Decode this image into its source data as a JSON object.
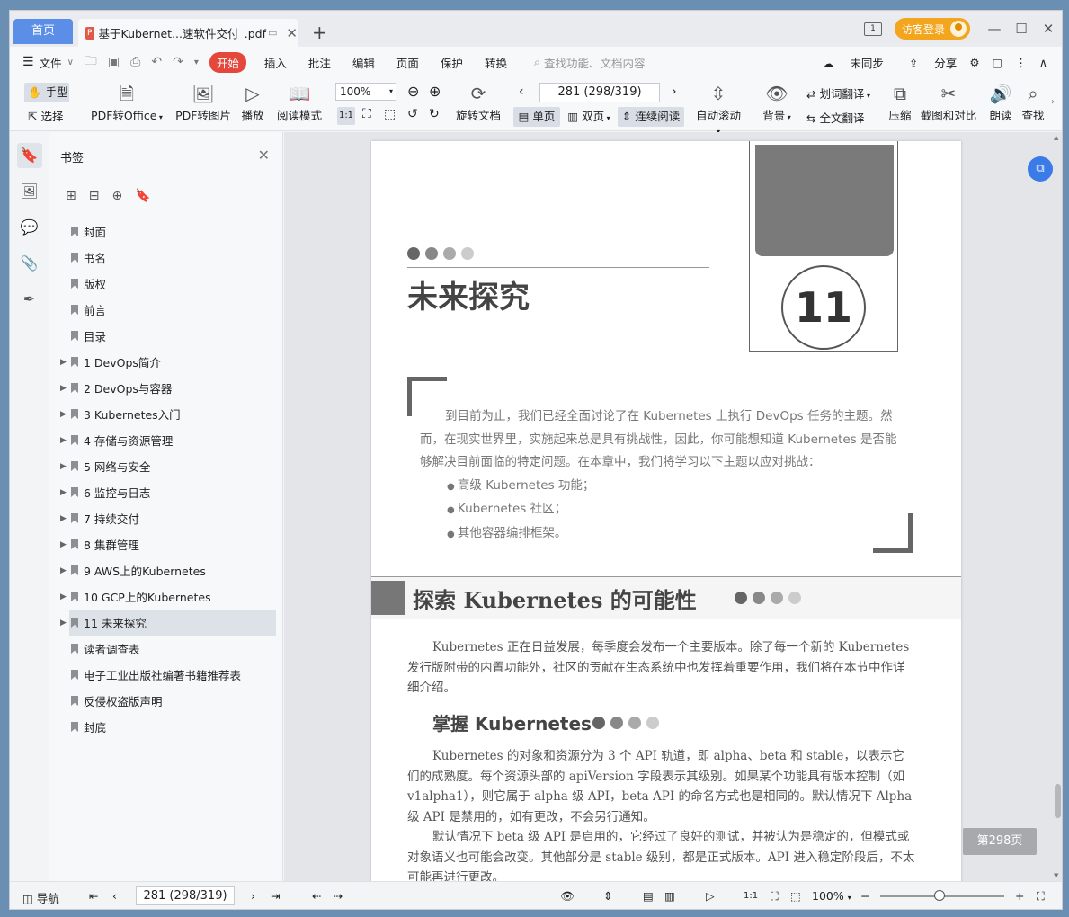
{
  "titlebar": {
    "home_tab": "首页",
    "doc_tab_title": "基于Kubernet...速软件交付_.pdf",
    "new_tab": "+",
    "box_icon_label": "1",
    "visitor_login": "访客登录"
  },
  "menubar": {
    "file": "文件",
    "start": "开始",
    "insert": "插入",
    "annotate": "批注",
    "edit": "编辑",
    "page": "页面",
    "protect": "保护",
    "convert": "转换",
    "search_placeholder": "查找功能、文档内容",
    "sync": "未同步",
    "share": "分享"
  },
  "ribbon": {
    "hand": "手型",
    "select": "选择",
    "pdf_to_office": "PDF转Office",
    "pdf_to_image": "PDF转图片",
    "play": "播放",
    "read_mode": "阅读模式",
    "zoom": "100%",
    "rotate_doc": "旋转文档",
    "page_indicator": "281 (298/319)",
    "single_page": "单页",
    "double_page": "双页",
    "continuous": "连续阅读",
    "auto_scroll": "自动滚动",
    "background": "背景",
    "word_translate": "划词翻译",
    "full_translate": "全文翻译",
    "compress": "压缩",
    "screenshot_compare": "截图和对比",
    "read_aloud": "朗读",
    "find": "查找"
  },
  "bookmarks": {
    "title": "书签",
    "items": [
      {
        "label": "封面",
        "expandable": false,
        "active": false
      },
      {
        "label": "书名",
        "expandable": false,
        "active": false
      },
      {
        "label": "版权",
        "expandable": false,
        "active": false
      },
      {
        "label": "前言",
        "expandable": false,
        "active": false
      },
      {
        "label": "目录",
        "expandable": false,
        "active": false
      },
      {
        "label": "1   DevOps简介",
        "expandable": true,
        "active": false
      },
      {
        "label": "2   DevOps与容器",
        "expandable": true,
        "active": false
      },
      {
        "label": "3   Kubernetes入门",
        "expandable": true,
        "active": false
      },
      {
        "label": "4   存储与资源管理",
        "expandable": true,
        "active": false
      },
      {
        "label": "5   网络与安全",
        "expandable": true,
        "active": false
      },
      {
        "label": "6   监控与日志",
        "expandable": true,
        "active": false
      },
      {
        "label": "7   持续交付",
        "expandable": true,
        "active": false
      },
      {
        "label": "8   集群管理",
        "expandable": true,
        "active": false
      },
      {
        "label": "9   AWS上的Kubernetes",
        "expandable": true,
        "active": false
      },
      {
        "label": "10   GCP上的Kubernetes",
        "expandable": true,
        "active": false
      },
      {
        "label": "11   未来探究",
        "expandable": true,
        "active": true
      },
      {
        "label": "读者调查表",
        "expandable": false,
        "active": false
      },
      {
        "label": "电子工业出版社编著书籍推荐表",
        "expandable": false,
        "active": false
      },
      {
        "label": "反侵权盗版声明",
        "expandable": false,
        "active": false
      },
      {
        "label": "封底",
        "expandable": false,
        "active": false
      }
    ]
  },
  "page": {
    "chapter_number": "11",
    "chapter_title": "未来探究",
    "intro_paragraph": "到目前为止，我们已经全面讨论了在 Kubernetes 上执行 DevOps 任务的主题。然而，在现实世界里，实施起来总是具有挑战性，因此，你可能想知道 Kubernetes 是否能够解决目前面临的特定问题。在本章中，我们将学习以下主题以应对挑战：",
    "intro_bullets": [
      "高级 Kubernetes 功能；",
      "Kubernetes 社区；",
      "其他容器编排框架。"
    ],
    "section_title": "探索 Kubernetes 的可能性",
    "section_paragraph": "Kubernetes 正在日益发展，每季度会发布一个主要版本。除了每一个新的 Kubernetes 发行版附带的内置功能外，社区的贡献在生态系统中也发挥着重要作用，我们将在本节中作详细介绍。",
    "subsection_title": "掌握 Kubernetes",
    "sub_paragraph_1": "Kubernetes 的对象和资源分为 3 个 API 轨道，即 alpha、beta 和 stable，以表示它们的成熟度。每个资源头部的 apiVersion 字段表示其级别。如果某个功能具有版本控制（如 v1alpha1），则它属于 alpha 级 API，beta API 的命名方式也是相同的。默认情况下 Alpha 级 API 是禁用的，如有更改，不会另行通知。",
    "sub_paragraph_2": "默认情况下 beta 级 API 是启用的，它经过了良好的测试，并被认为是稳定的，但模式或对象语义也可能会改变。其他部分是 stable 级别，都是正式版本。API 进入稳定阶段后，不太可能再进行更改。"
  },
  "page_badge": "第298页",
  "statusbar": {
    "nav": "导航",
    "page_indicator": "281 (298/319)",
    "zoom": "100%"
  }
}
